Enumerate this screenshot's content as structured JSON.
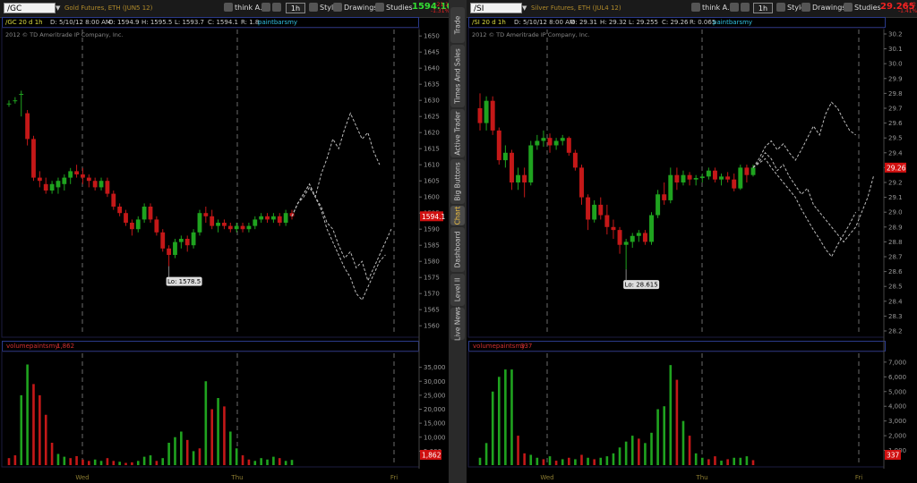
{
  "left": {
    "symbol": "/GC",
    "description": "Gold Futures, ETH (JUN5 12)",
    "think_label": "think A.I.",
    "timeframe": "1h",
    "style_label": "Style",
    "drawings_label": "Drawings",
    "studies_label": "Studies",
    "last_price": "1594.10",
    "net_change_top": "-21.1",
    "net_change_bottom": "-1.31%",
    "header": {
      "symbol_period": "/GC 20 d 1h",
      "date": "D: 5/10/12 8:00 AM",
      "open": "O: 1594.9",
      "high": "H: 1595.5",
      "low": "L: 1593.7",
      "close": "C: 1594.1",
      "range": "R: 1.8",
      "study": "paintbarsmy"
    },
    "copyright": "2012 © TD Ameritrade IP Company, Inc.",
    "price_badge": "1594.1",
    "low_label": "Lo: 1578.5",
    "volume_study": "volumepaintsmy",
    "volume_value": "1,862",
    "volume_badge": "1,862",
    "days": [
      "Wed",
      "Thu",
      "Fri"
    ]
  },
  "right": {
    "symbol": "/SI",
    "description": "Silver Futures, ETH (JUL4 12)",
    "think_label": "think A.I.",
    "timeframe": "1h",
    "style_label": "Style",
    "drawings_label": "Drawings",
    "studies_label": "Studies",
    "last_price": "29.265",
    "net_change_top": "-0.42",
    "net_change_bottom": "-1.41%",
    "header": {
      "symbol_period": "/SI 20 d 1h",
      "date": "D: 5/10/12 8:00 AM",
      "open": "O: 29.31",
      "high": "H: 29.32",
      "low": "L: 29.255",
      "close": "C: 29.26",
      "range": "R: 0.065",
      "study": "paintbarsmy"
    },
    "copyright": "2012 © TD Ameritrade IP Company, Inc.",
    "price_badge": "29.26",
    "low_label": "Lo: 28.615",
    "volume_study": "volumepaintsmy",
    "volume_value": "337",
    "volume_badge": "337",
    "days": [
      "Wed",
      "Thu",
      "Fri"
    ]
  },
  "side_tabs": [
    "Trade",
    "Times And Sales",
    "Active Trader",
    "Big Buttons",
    "Chart",
    "Dashboard",
    "Level II",
    "Live News"
  ],
  "active_tab": "Chart",
  "colors": {
    "up": "#1fa31f",
    "down": "#c41818",
    "price_up": "#33dd33",
    "price_down": "#ee2222",
    "badge": "#d01010"
  },
  "chart_data": [
    {
      "type": "candlestick",
      "name": "/GC 20 d 1h",
      "y_ticks": [
        1560,
        1565,
        1570,
        1575,
        1580,
        1585,
        1590,
        1595,
        1600,
        1605,
        1610,
        1615,
        1620,
        1625,
        1630,
        1635,
        1640,
        1645,
        1650
      ],
      "ylim": [
        1557,
        1652
      ],
      "x_labels": [
        "Wed",
        "Thu",
        "Fri"
      ],
      "candles": [
        [
          1629,
          1630,
          1628,
          1629
        ],
        [
          1630,
          1631,
          1629,
          1630
        ],
        [
          1632,
          1633,
          1625,
          1632
        ],
        [
          1626,
          1627,
          1616,
          1618
        ],
        [
          1618,
          1619,
          1605,
          1606
        ],
        [
          1606,
          1608,
          1603,
          1605
        ],
        [
          1604,
          1606,
          1601,
          1602
        ],
        [
          1602,
          1605,
          1601,
          1604
        ],
        [
          1603,
          1606,
          1601,
          1605
        ],
        [
          1604,
          1607,
          1602,
          1606
        ],
        [
          1606,
          1609,
          1604,
          1608
        ],
        [
          1608,
          1610,
          1606,
          1607
        ],
        [
          1607,
          1609,
          1604,
          1606
        ],
        [
          1606,
          1607,
          1603,
          1605
        ],
        [
          1605,
          1606,
          1602,
          1603
        ],
        [
          1603,
          1606,
          1602,
          1605
        ],
        [
          1605,
          1606,
          1600,
          1601
        ],
        [
          1601,
          1602,
          1596,
          1597
        ],
        [
          1597,
          1598,
          1594,
          1595
        ],
        [
          1595,
          1596,
          1591,
          1592
        ],
        [
          1592,
          1593,
          1588,
          1590
        ],
        [
          1590,
          1594,
          1589,
          1593
        ],
        [
          1593,
          1598,
          1592,
          1597
        ],
        [
          1597,
          1598,
          1592,
          1593
        ],
        [
          1593,
          1594,
          1588,
          1589
        ],
        [
          1589,
          1590,
          1583,
          1584
        ],
        [
          1584,
          1585,
          1578.5,
          1582
        ],
        [
          1582,
          1587,
          1581,
          1586
        ],
        [
          1586,
          1588,
          1584,
          1587
        ],
        [
          1587,
          1588,
          1583,
          1585
        ],
        [
          1585,
          1590,
          1584,
          1589
        ],
        [
          1589,
          1596,
          1588,
          1595
        ],
        [
          1595,
          1597,
          1592,
          1594
        ],
        [
          1594,
          1596,
          1590,
          1591
        ],
        [
          1591,
          1593,
          1589,
          1592
        ],
        [
          1592,
          1593,
          1590,
          1591
        ],
        [
          1591,
          1592,
          1589,
          1590
        ],
        [
          1590,
          1592,
          1589,
          1591
        ],
        [
          1591,
          1592,
          1589,
          1590
        ],
        [
          1590,
          1592,
          1589,
          1591
        ],
        [
          1591,
          1594,
          1590,
          1593
        ],
        [
          1593,
          1595,
          1592,
          1594
        ],
        [
          1594,
          1595,
          1592,
          1593
        ],
        [
          1593,
          1595,
          1592,
          1594
        ],
        [
          1594,
          1595,
          1591,
          1592
        ],
        [
          1592,
          1596,
          1591,
          1595
        ],
        [
          1595,
          1596,
          1593,
          1594
        ]
      ],
      "projections": [
        [
          1594,
          1598,
          1600,
          1603,
          1600,
          1607,
          1612,
          1618,
          1615,
          1621,
          1626,
          1622,
          1618,
          1620,
          1614,
          1610
        ],
        [
          1594,
          1598,
          1601,
          1604,
          1600,
          1597,
          1592,
          1590,
          1585,
          1581,
          1583,
          1578,
          1580,
          1574,
          1578,
          1582,
          1586,
          1590
        ],
        [
          1594,
          1598,
          1601,
          1604,
          1600,
          1596,
          1590,
          1586,
          1582,
          1578,
          1575,
          1570,
          1568,
          1572,
          1576,
          1580,
          1582
        ]
      ],
      "volume": {
        "y_ticks": [
          5000,
          10000,
          15000,
          20000,
          25000,
          30000,
          35000
        ],
        "ylim": [
          0,
          40000
        ],
        "bars": [
          [
            2500,
            "down"
          ],
          [
            3500,
            "down"
          ],
          [
            25000,
            "up"
          ],
          [
            36000,
            "up"
          ],
          [
            29000,
            "down"
          ],
          [
            25000,
            "down"
          ],
          [
            18000,
            "down"
          ],
          [
            8000,
            "down"
          ],
          [
            4000,
            "up"
          ],
          [
            3000,
            "up"
          ],
          [
            2500,
            "down"
          ],
          [
            3200,
            "down"
          ],
          [
            2000,
            "down"
          ],
          [
            1500,
            "down"
          ],
          [
            2000,
            "up"
          ],
          [
            1500,
            "up"
          ],
          [
            2500,
            "down"
          ],
          [
            1500,
            "down"
          ],
          [
            1200,
            "up"
          ],
          [
            800,
            "down"
          ],
          [
            1000,
            "down"
          ],
          [
            1500,
            "up"
          ],
          [
            3000,
            "up"
          ],
          [
            3500,
            "up"
          ],
          [
            1500,
            "down"
          ],
          [
            2500,
            "up"
          ],
          [
            8000,
            "up"
          ],
          [
            10000,
            "up"
          ],
          [
            12000,
            "up"
          ],
          [
            9000,
            "down"
          ],
          [
            5000,
            "up"
          ],
          [
            6000,
            "down"
          ],
          [
            30000,
            "up"
          ],
          [
            20000,
            "down"
          ],
          [
            24000,
            "up"
          ],
          [
            21000,
            "down"
          ],
          [
            12000,
            "up"
          ],
          [
            6000,
            "up"
          ],
          [
            3500,
            "down"
          ],
          [
            2000,
            "down"
          ],
          [
            1500,
            "up"
          ],
          [
            2500,
            "up"
          ],
          [
            2000,
            "up"
          ],
          [
            3000,
            "up"
          ],
          [
            2500,
            "down"
          ],
          [
            1500,
            "up"
          ],
          [
            1862,
            "up"
          ]
        ]
      }
    },
    {
      "type": "candlestick",
      "name": "/SI 20 d 1h",
      "y_ticks": [
        28.2,
        28.3,
        28.4,
        28.5,
        28.6,
        28.7,
        28.8,
        28.9,
        29.0,
        29.1,
        29.2,
        29.3,
        29.4,
        29.5,
        29.6,
        29.7,
        29.8,
        29.9,
        30.0,
        30.1,
        30.2
      ],
      "ylim": [
        28.17,
        30.23
      ],
      "x_labels": [
        "Wed",
        "Thu",
        "Fri"
      ],
      "candles": [
        [
          29.7,
          29.8,
          29.55,
          29.6
        ],
        [
          29.6,
          29.78,
          29.55,
          29.75
        ],
        [
          29.75,
          29.78,
          29.52,
          29.55
        ],
        [
          29.55,
          29.57,
          29.32,
          29.35
        ],
        [
          29.35,
          29.45,
          29.3,
          29.4
        ],
        [
          29.4,
          29.42,
          29.15,
          29.2
        ],
        [
          29.2,
          29.3,
          29.15,
          29.25
        ],
        [
          29.25,
          29.3,
          29.1,
          29.2
        ],
        [
          29.2,
          29.48,
          29.18,
          29.45
        ],
        [
          29.45,
          29.52,
          29.42,
          29.48
        ],
        [
          29.48,
          29.55,
          29.44,
          29.5
        ],
        [
          29.5,
          29.53,
          29.4,
          29.45
        ],
        [
          29.45,
          29.5,
          29.42,
          29.48
        ],
        [
          29.48,
          29.52,
          29.45,
          29.5
        ],
        [
          29.5,
          29.51,
          29.38,
          29.4
        ],
        [
          29.4,
          29.42,
          29.28,
          29.3
        ],
        [
          29.3,
          29.32,
          29.05,
          29.1
        ],
        [
          29.1,
          29.12,
          28.88,
          28.95
        ],
        [
          28.95,
          29.08,
          28.93,
          29.05
        ],
        [
          29.05,
          29.1,
          28.95,
          28.98
        ],
        [
          28.98,
          29.05,
          28.85,
          28.9
        ],
        [
          28.9,
          28.95,
          28.82,
          28.88
        ],
        [
          28.88,
          28.9,
          28.72,
          28.78
        ],
        [
          28.78,
          28.82,
          28.615,
          28.8
        ],
        [
          28.8,
          28.86,
          28.76,
          28.84
        ],
        [
          28.84,
          28.88,
          28.8,
          28.86
        ],
        [
          28.86,
          28.88,
          28.78,
          28.8
        ],
        [
          28.8,
          29.0,
          28.78,
          28.98
        ],
        [
          28.98,
          29.15,
          28.96,
          29.12
        ],
        [
          29.12,
          29.2,
          29.05,
          29.08
        ],
        [
          29.08,
          29.3,
          29.06,
          29.25
        ],
        [
          29.25,
          29.3,
          29.15,
          29.2
        ],
        [
          29.2,
          29.28,
          29.18,
          29.25
        ],
        [
          29.25,
          29.27,
          29.18,
          29.22
        ],
        [
          29.22,
          29.25,
          29.18,
          29.23
        ],
        [
          29.23,
          29.26,
          29.2,
          29.24
        ],
        [
          29.24,
          29.3,
          29.22,
          29.28
        ],
        [
          29.28,
          29.3,
          29.2,
          29.22
        ],
        [
          29.22,
          29.26,
          29.18,
          29.24
        ],
        [
          29.24,
          29.27,
          29.2,
          29.22
        ],
        [
          29.22,
          29.26,
          29.14,
          29.16
        ],
        [
          29.16,
          29.32,
          29.15,
          29.3
        ],
        [
          29.3,
          29.32,
          29.2,
          29.25
        ],
        [
          29.25,
          29.32,
          29.24,
          29.3
        ]
      ],
      "projections": [
        [
          29.3,
          29.36,
          29.44,
          29.48,
          29.42,
          29.46,
          29.4,
          29.35,
          29.42,
          29.5,
          29.58,
          29.52,
          29.66,
          29.74,
          29.7,
          29.62,
          29.55,
          29.52
        ],
        [
          29.3,
          29.34,
          29.4,
          29.36,
          29.28,
          29.32,
          29.24,
          29.18,
          29.12,
          29.16,
          29.05,
          29.0,
          28.95,
          28.9,
          28.85,
          28.8,
          28.85,
          28.9,
          29.0,
          29.1,
          29.25
        ],
        [
          29.3,
          29.33,
          29.36,
          29.3,
          29.25,
          29.2,
          29.15,
          29.1,
          29.02,
          28.95,
          28.88,
          28.82,
          28.75,
          28.7,
          28.78,
          28.85,
          28.92,
          29.0
        ]
      ],
      "volume": {
        "y_ticks": [
          1000,
          2000,
          3000,
          4000,
          5000,
          6000,
          7000
        ],
        "ylim": [
          0,
          7600
        ],
        "bars": [
          [
            500,
            "up"
          ],
          [
            1500,
            "up"
          ],
          [
            5000,
            "up"
          ],
          [
            6000,
            "up"
          ],
          [
            6500,
            "up"
          ],
          [
            6500,
            "up"
          ],
          [
            2000,
            "down"
          ],
          [
            800,
            "down"
          ],
          [
            700,
            "up"
          ],
          [
            500,
            "up"
          ],
          [
            400,
            "down"
          ],
          [
            600,
            "up"
          ],
          [
            300,
            "down"
          ],
          [
            400,
            "up"
          ],
          [
            500,
            "down"
          ],
          [
            400,
            "up"
          ],
          [
            700,
            "down"
          ],
          [
            500,
            "up"
          ],
          [
            400,
            "down"
          ],
          [
            500,
            "up"
          ],
          [
            600,
            "up"
          ],
          [
            800,
            "up"
          ],
          [
            1200,
            "up"
          ],
          [
            1600,
            "up"
          ],
          [
            2000,
            "up"
          ],
          [
            1800,
            "down"
          ],
          [
            1500,
            "up"
          ],
          [
            2200,
            "up"
          ],
          [
            3800,
            "up"
          ],
          [
            4000,
            "up"
          ],
          [
            6800,
            "up"
          ],
          [
            5800,
            "down"
          ],
          [
            3000,
            "up"
          ],
          [
            2000,
            "down"
          ],
          [
            800,
            "up"
          ],
          [
            500,
            "up"
          ],
          [
            400,
            "down"
          ],
          [
            600,
            "down"
          ],
          [
            300,
            "up"
          ],
          [
            400,
            "down"
          ],
          [
            500,
            "up"
          ],
          [
            500,
            "up"
          ],
          [
            600,
            "up"
          ],
          [
            337,
            "down"
          ]
        ]
      }
    }
  ]
}
